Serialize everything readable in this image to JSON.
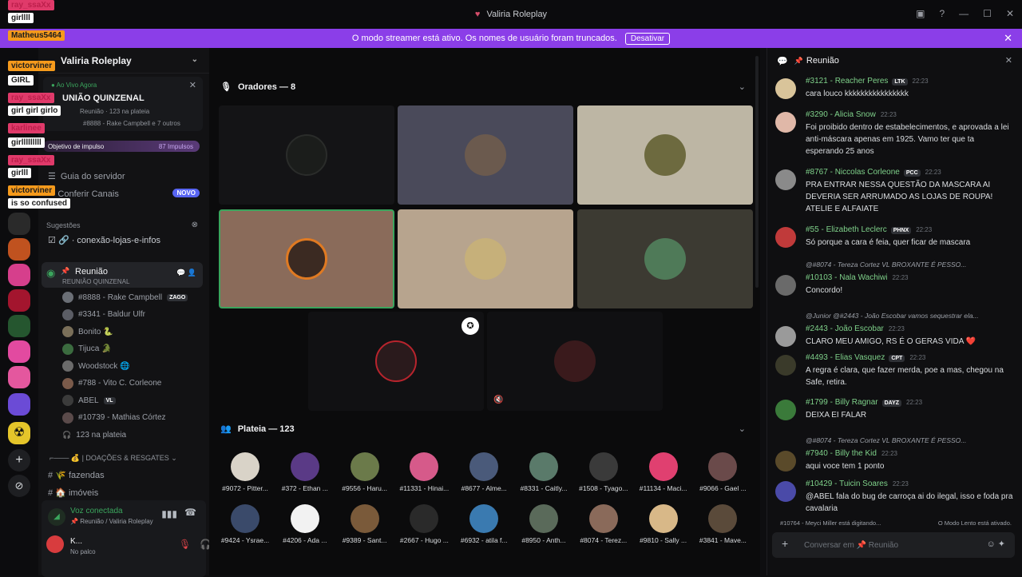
{
  "window": {
    "title": "Valiria Roleplay"
  },
  "banner": {
    "text": "O modo streamer está ativo. Os nomes de usuário foram truncados.",
    "button": "Desativar"
  },
  "overlay_chat": [
    {
      "text": "ray_ssaXx",
      "style": "pink"
    },
    {
      "text": "girllll",
      "style": "white"
    },
    {
      "text": "Matheus5464",
      "style": "orange"
    },
    {
      "text": "victorviner",
      "style": "orange"
    },
    {
      "text": "GIRL",
      "style": "white"
    },
    {
      "text": "ray_ssaXx",
      "style": "pink"
    },
    {
      "text": "girl girl girlo",
      "style": "white"
    },
    {
      "text": "karlinee",
      "style": "pink"
    },
    {
      "text": "girlllllllll",
      "style": "white"
    },
    {
      "text": "ray_ssaXx",
      "style": "pink"
    },
    {
      "text": "girlll",
      "style": "white"
    },
    {
      "text": "victorviner",
      "style": "orange"
    },
    {
      "text": "is so confused",
      "style": "white"
    }
  ],
  "sidebar": {
    "server_name": "Valiria Roleplay",
    "live": {
      "tag": "Ao Vivo Agora",
      "name": "UNIÃO QUINZENAL",
      "meta": "Reunião · 123 na plateia",
      "meta2": "#8888 - Rake Campbell e 7 outros"
    },
    "boost": {
      "label": "Objetivo de impulso",
      "count": "87 Impulsos"
    },
    "nav": [
      {
        "label": "Guia do servidor"
      },
      {
        "label": "Conferir Canais",
        "badge": "NOVO"
      }
    ],
    "suggestions_label": "Sugestões",
    "suggested_channel": "conexão-lojas-e-infos",
    "stage": {
      "title": "Reunião",
      "subtitle": "REUNIÃO QUINZENAL"
    },
    "members": [
      {
        "name": "#8888 - Rake Campbell",
        "badge": "ZAGO"
      },
      {
        "name": "#3341 - Baldur Ulfr",
        "badge": ""
      },
      {
        "name": "Bonito 🐍",
        "badge": ""
      },
      {
        "name": "Tijuca 🐊",
        "badge": ""
      },
      {
        "name": "Woodstock 🌐",
        "badge": ""
      },
      {
        "name": "#788 - Vito C. Corleone",
        "badge": ""
      },
      {
        "name": "ABEL",
        "badge": "VL"
      },
      {
        "name": "#10739 - Mathias Córtez",
        "badge": ""
      },
      {
        "name": "123 na plateia",
        "badge": ""
      }
    ],
    "category": "| DOAÇÕES & RESGATES",
    "channels": [
      "fazendas",
      "imóveis"
    ],
    "voice": {
      "status": "Voz conectada",
      "where": "Reunião / Valiria Roleplay"
    },
    "user": {
      "name": "K...",
      "status": "No palco"
    }
  },
  "stage": {
    "speakers_label": "Oradores — 8",
    "audience_label": "Plateia — 123",
    "audience": [
      "#9072 - Pitter...",
      "#372 - Ethan ...",
      "#9556 - Haru...",
      "#11331 - Hinai...",
      "#8677 - Alme...",
      "#8331 - Caitly...",
      "#1508 - Tyago...",
      "#11134 - Maci...",
      "#9066 - Gael ...",
      "#9424 - Ysrae...",
      "#4206 - Ada ...",
      "#9389 - Sant...",
      "#2667 - Hugo ...",
      "#6932 - atila f...",
      "#8950 - Anth...",
      "#8074 - Terez...",
      "#9810 - Sally ...",
      "#3841 - Mave..."
    ]
  },
  "chat": {
    "title": "Reunião",
    "messages": [
      {
        "name": "#3121 - Reacher Peres",
        "badge": "LTK",
        "time": "22:23",
        "text": "cara louco kkkkkkkkkkkkkkkk"
      },
      {
        "name": "#3290 - Alicia Snow",
        "badge": "",
        "time": "22:23",
        "text": "Foi proibido dentro de estabelecimentos, e aprovada a lei anti-máscara apenas em 1925. Vamo ter que ta esperando 25 anos"
      },
      {
        "name": "#8767 - Niccolas Corleone",
        "badge": "PCC",
        "time": "22:23",
        "text": "PRA ENTRAR NESSA QUESTÃO DA MASCARA AI DEVERIA SER ARRUMADO AS LOJAS DE ROUPA! ATELIE E ALFAIATE"
      },
      {
        "name": "#55 - Elizabeth Leclerc",
        "badge": "PHNX",
        "time": "22:23",
        "text": "Só porque a cara é feia, quer ficar de mascara"
      },
      {
        "name": "#10103 - Nala Wachiwi",
        "badge": "",
        "time": "22:23",
        "text": "Concordo!",
        "reply": "@#8074 - Tereza Cortez  VL  BROXANTE É PESSO..."
      },
      {
        "name": "#2443 - João Escobar",
        "badge": "",
        "time": "22:23",
        "text": "CLARO MEU AMIGO, RS É O GERAS VIDA ❤️",
        "reply": "@Junior  @#2443 - João Escobar  vamos sequestrar ela..."
      },
      {
        "name": "#4493 - Elias Vasquez",
        "badge": "CPT",
        "time": "22:23",
        "text": "A regra é clara, que fazer merda, poe a mas, chegou na Safe, retira."
      },
      {
        "name": "#1799 - Billy  Ragnar",
        "badge": "DAYZ",
        "time": "22:23",
        "text": "DEIXA EI FALAR"
      },
      {
        "name": "#7940 - Billy the Kid",
        "badge": "",
        "time": "22:23",
        "text": "aqui voce tem 1 ponto",
        "reply": "@#8074 - Tereza Cortez  VL  BROXANTE É PESSO..."
      },
      {
        "name": "#10429 - Tuicin Soares",
        "badge": "",
        "time": "22:23",
        "text": "@ABEL fala do bug de carroça ai do ilegal, isso e foda pra cavalaria"
      }
    ],
    "typing": "#10764 - Meyci Miller está digitando...",
    "slowmode": "O Modo Lento está ativado.",
    "compose_placeholder": "Conversar em 📌 Reunião"
  },
  "colors": {
    "banner": "#8b3ee8",
    "accent_green": "#3ba55d",
    "name_green": "#7fd18a"
  }
}
